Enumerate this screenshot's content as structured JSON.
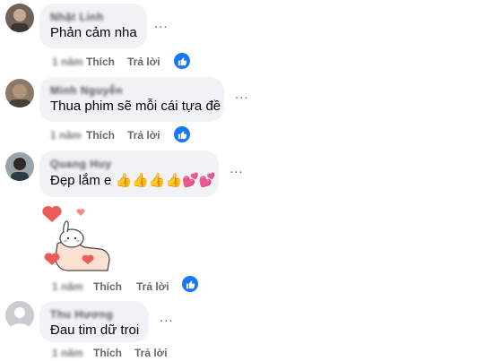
{
  "comments": [
    {
      "name": "Nhật Linh",
      "text": "Phản cảm nha",
      "more": "...",
      "time": "1 năm",
      "like": "Thích",
      "reply": "Trả lời"
    },
    {
      "name": "Minh Nguyễn",
      "text": "Thua phim sẽ mỗi cái tựa đề",
      "more": "...",
      "time": "1 năm",
      "like": "Thích",
      "reply": "Trả lời"
    },
    {
      "name": "Quang Huy",
      "text": "Đẹp lắm e 👍👍👍👍💕💕",
      "more": "...",
      "time": "1 năm",
      "like": "Thích",
      "reply": "Trả lời"
    },
    {
      "name": "Thu Hương",
      "text": "Đau tim dữ troi",
      "more": "...",
      "time": "1 năm",
      "like": "Thích",
      "reply": "Trả lời"
    }
  ],
  "colors": {
    "like_badge": "#1877f2",
    "bubble": "#f0f2f5",
    "secondary_text": "#65676b"
  },
  "icons": {
    "like_badge": "thumbs-up-icon",
    "more": "more-options-icon",
    "sticker": "heart-hand-sticker"
  }
}
